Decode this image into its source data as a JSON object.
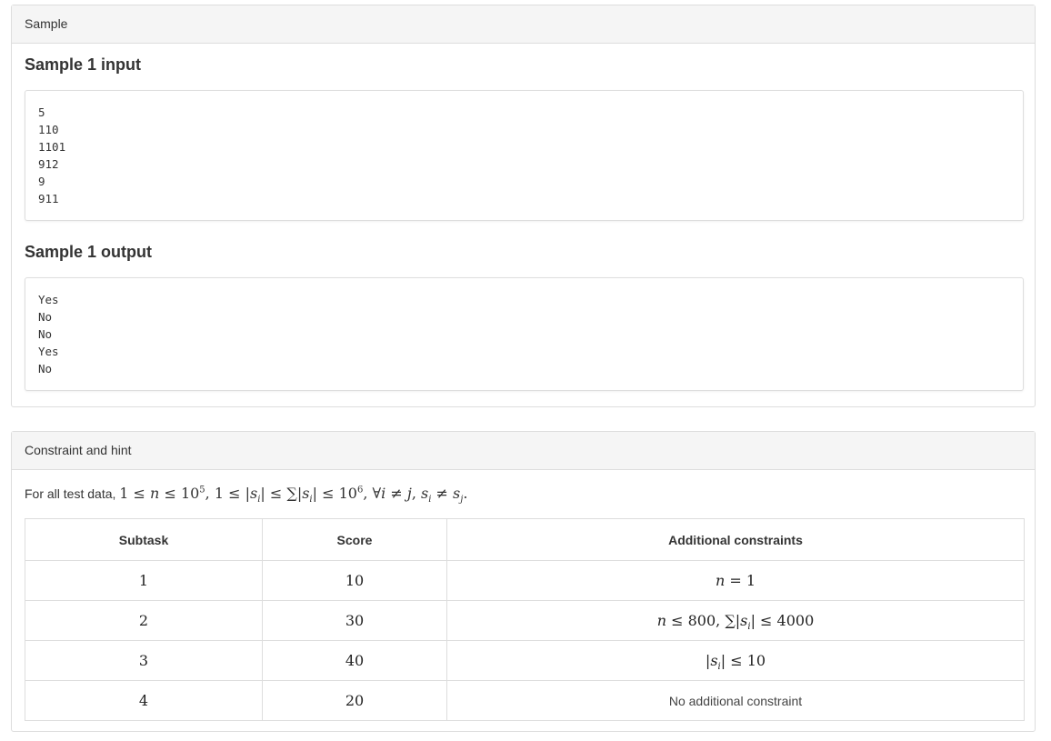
{
  "sample_panel": {
    "heading": "Sample",
    "input_title": "Sample 1 input",
    "input_text": "5\n110\n1101\n912\n9\n911",
    "output_title": "Sample 1 output",
    "output_text": "Yes\nNo\nNo\nYes\nNo"
  },
  "hint_panel": {
    "heading": "Constraint and hint",
    "intro": "For all test data,"
  },
  "table": {
    "headers": [
      "Subtask",
      "Score",
      "Additional constraints"
    ],
    "rows": [
      {
        "subtask": "1",
        "score": "10"
      },
      {
        "subtask": "2",
        "score": "30"
      },
      {
        "subtask": "3",
        "score": "40"
      },
      {
        "subtask": "4",
        "score": "20",
        "constraint": "No additional constraint"
      }
    ]
  }
}
